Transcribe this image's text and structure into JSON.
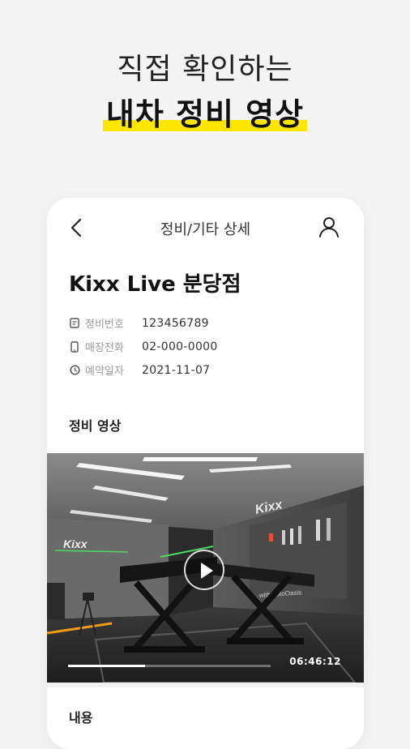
{
  "headline": {
    "line1": "직접 확인하는",
    "line2": "내차 정비 영상",
    "highlight_color": "#ffe600"
  },
  "app": {
    "title": "정비/기타 상세",
    "back_icon": "chevron-left-icon",
    "user_icon": "user-icon"
  },
  "shop": {
    "name": "Kixx Live 분당점"
  },
  "info": [
    {
      "icon": "document-icon",
      "label": "정비번호",
      "value": "123456789"
    },
    {
      "icon": "phone-icon",
      "label": "매장전화",
      "value": "02-000-0000"
    },
    {
      "icon": "clock-icon",
      "label": "예약일자",
      "value": "2021-11-07"
    }
  ],
  "video_section": {
    "title": "정비 영상",
    "video": {
      "time": "06:46:12",
      "progress": 0.38,
      "sign_text": "Kixx",
      "sign_sub": "with autoOasis"
    }
  },
  "contents_section": {
    "title": "내용"
  }
}
